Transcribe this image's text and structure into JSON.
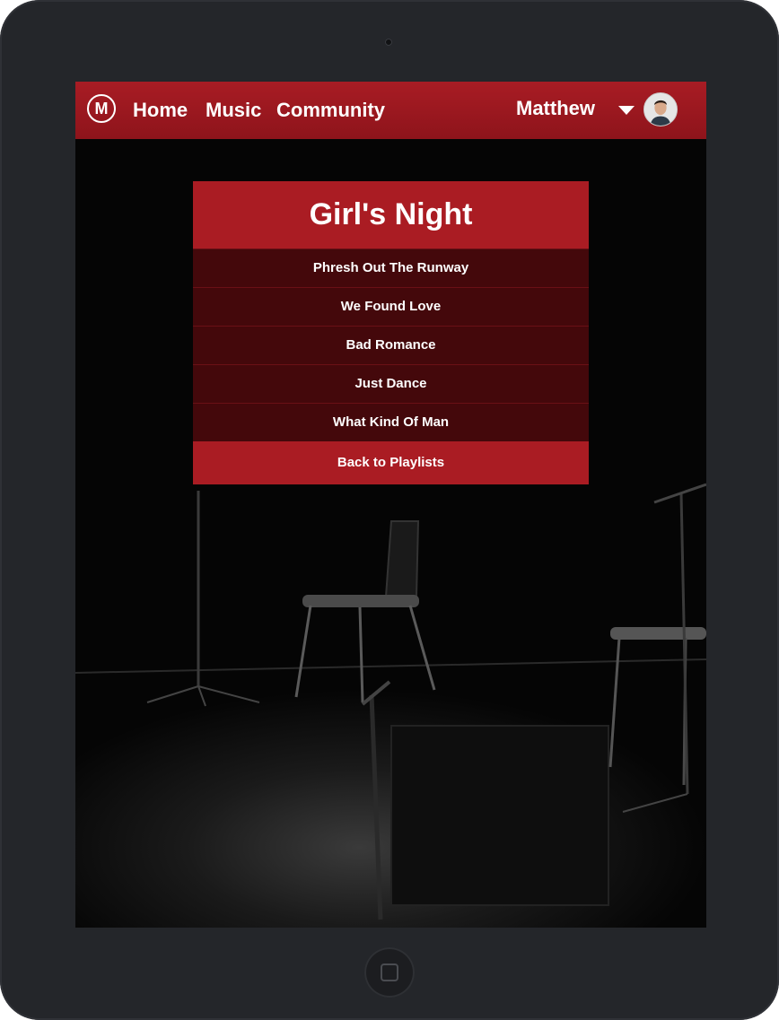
{
  "nav": {
    "logo_letter": "M",
    "links": [
      "Home",
      "Music",
      "Community"
    ],
    "user_name": "Matthew"
  },
  "playlist": {
    "title": "Girl's Night",
    "tracks": [
      "Phresh Out The Runway",
      "We Found Love",
      "Bad Romance",
      "Just Dance",
      "What Kind Of Man"
    ],
    "back_label": "Back to Playlists"
  },
  "colors": {
    "brand_red": "#aa1c23",
    "track_bg": "#48080c",
    "device_frame": "#24262a"
  },
  "icons": {
    "logo": "m-circle-logo",
    "user_menu": "caret-down-icon",
    "avatar": "user-avatar",
    "home": "home-button"
  }
}
